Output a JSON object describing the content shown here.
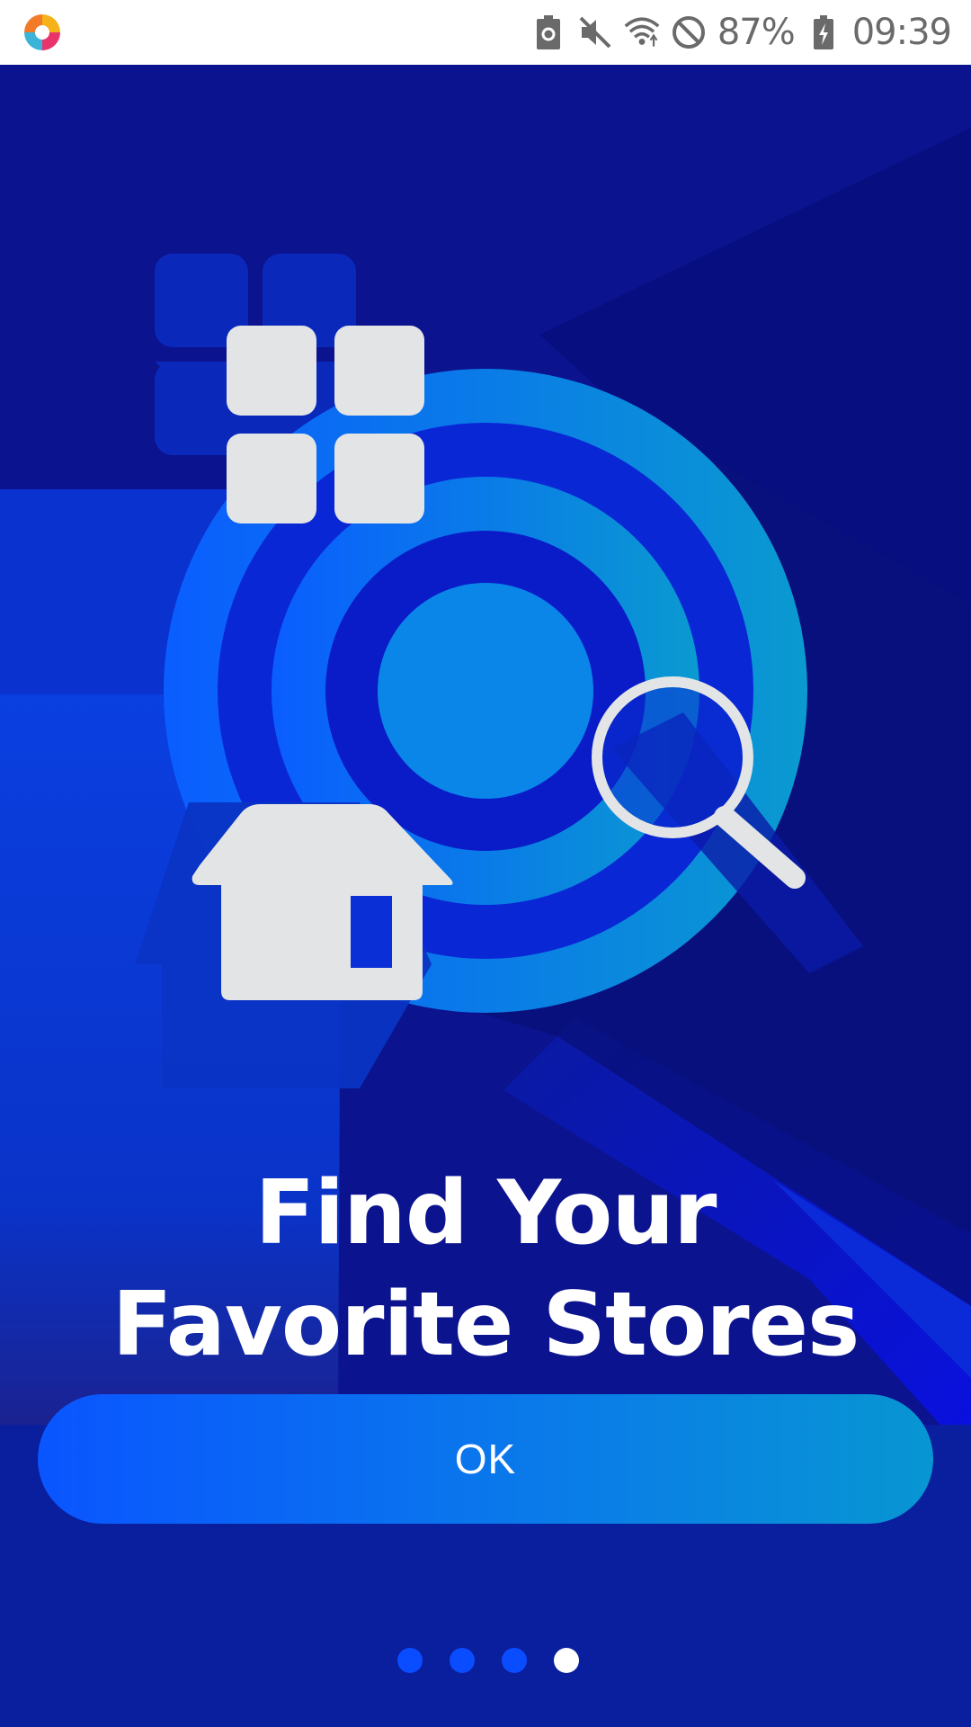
{
  "status_bar": {
    "battery_percent": "87%",
    "time": "09:39",
    "icons": [
      "app-logo-icon",
      "battery-saver-icon",
      "mute-icon",
      "wifi-icon",
      "do-not-disturb-icon",
      "battery-charging-icon"
    ]
  },
  "onboarding": {
    "title": "Find Your Favorite Stores",
    "illustration_icons": [
      "grid-icon",
      "target-icon",
      "house-icon",
      "magnifier-icon"
    ],
    "ok_label": "OK",
    "pages_total": 4,
    "current_page": 4
  },
  "colors": {
    "background": "#0a1590",
    "accent": "#0a55ff",
    "button_end": "#0896d2",
    "icon_fill": "#e3e4e6",
    "target_ring": "#0a7de8"
  }
}
